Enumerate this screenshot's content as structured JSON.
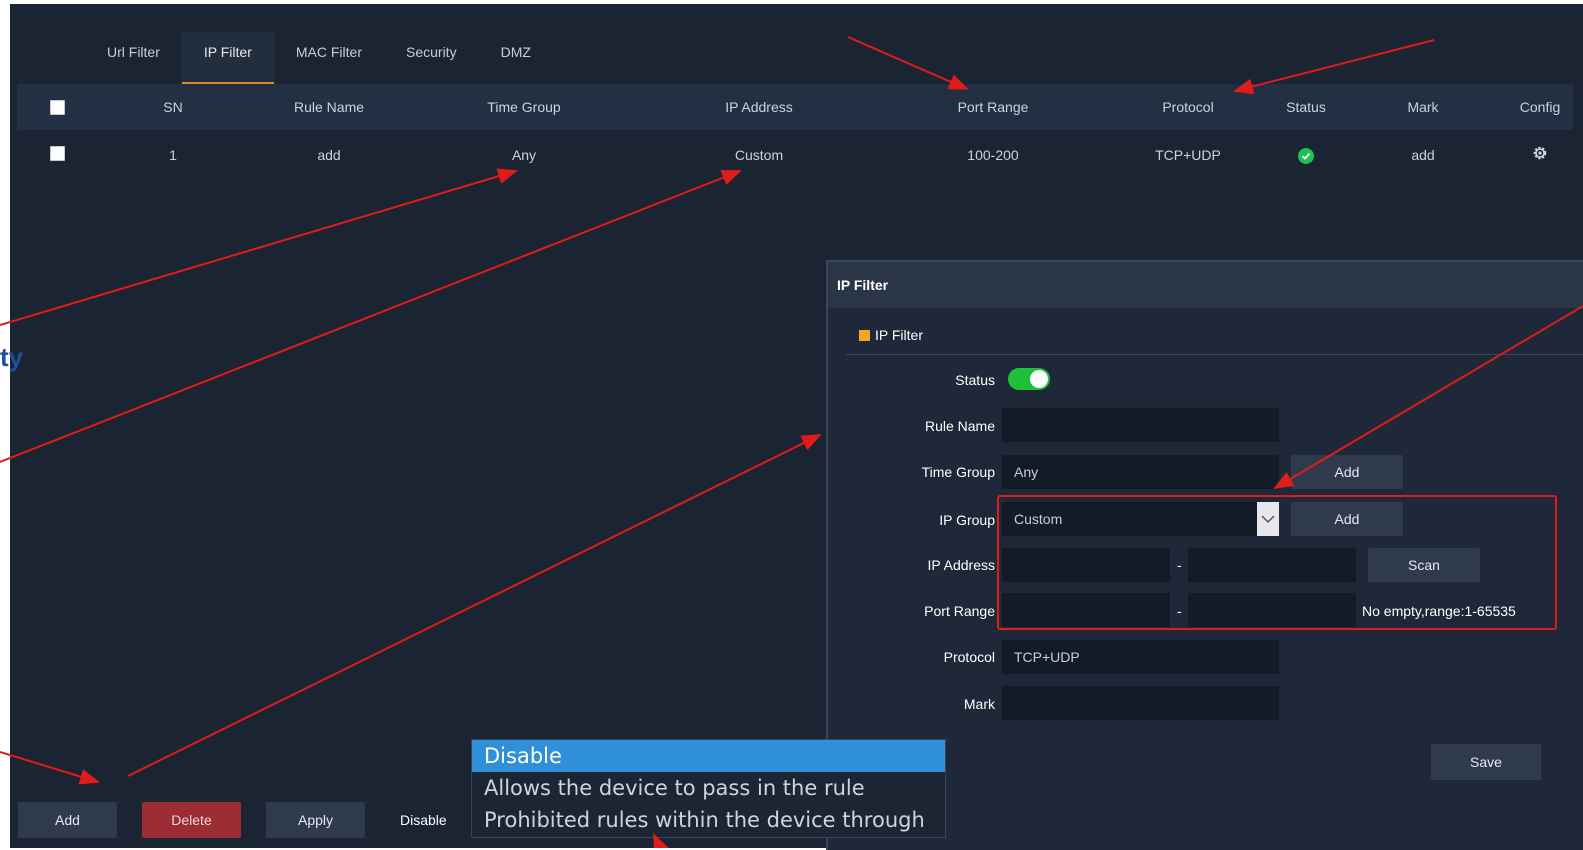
{
  "side_fragment": "ty",
  "tabs": [
    "Url Filter",
    "IP Filter",
    "MAC Filter",
    "Security",
    "DMZ"
  ],
  "active_tab": "IP Filter",
  "table": {
    "headers": [
      "SN",
      "Rule Name",
      "Time Group",
      "IP Address",
      "Port Range",
      "Protocol",
      "Status",
      "Mark",
      "Config"
    ],
    "rows": [
      {
        "sn": "1",
        "rule_name": "add",
        "time_group": "Any",
        "ip_address": "Custom",
        "port_range": "100-200",
        "protocol": "TCP+UDP",
        "status": "enabled",
        "mark": "add"
      }
    ]
  },
  "modal": {
    "title": "IP Filter",
    "section": "IP Filter",
    "fields": {
      "status_label": "Status",
      "rule_name_label": "Rule Name",
      "time_group_label": "Time Group",
      "time_group_value": "Any",
      "ip_group_label": "IP Group",
      "ip_group_value": "Custom",
      "ip_address_label": "IP Address",
      "port_range_label": "Port Range",
      "protocol_label": "Protocol",
      "protocol_value": "TCP+UDP",
      "mark_label": "Mark",
      "dash": "-",
      "port_hint": "No empty,range:1-65535"
    },
    "buttons": {
      "add": "Add",
      "scan": "Scan",
      "save": "Save"
    },
    "status_on": true
  },
  "bottom": {
    "add": "Add",
    "delete": "Delete",
    "apply": "Apply",
    "dropdown_value": "Disable",
    "dropdown_options": [
      "Disable",
      "Allows the device to pass in the rule",
      "Prohibited rules within the device through"
    ]
  },
  "colors": {
    "background": "#1b2432",
    "header": "#233044",
    "accent_tab": "#e2862a",
    "toggle_on": "#1fbf3a",
    "annotation": "#e01b1b",
    "selected_option": "#2f90d9"
  }
}
